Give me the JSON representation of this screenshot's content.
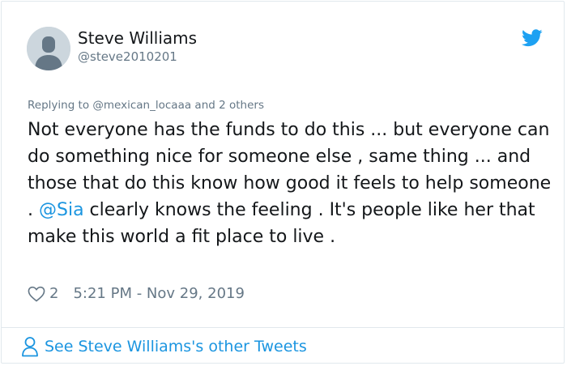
{
  "author": {
    "name": "Steve Williams",
    "handle": "@steve2010201"
  },
  "reply_context": {
    "prefix": "Replying to ",
    "user": "@mexican_locaaa",
    "suffix": " and 2 others"
  },
  "tweet": {
    "text_before": "Not everyone has the funds to do this ... but everyone can do something nice for someone else , same thing ... and those that do this know how good it feels to help someone . ",
    "mention": "@Sia",
    "text_after": " clearly knows the feeling . It's people like her that make this world a fit place to live ."
  },
  "meta": {
    "likes": "2",
    "timestamp": "5:21 PM - Nov 29, 2019"
  },
  "footer": {
    "link_label": "See Steve Williams's other Tweets"
  },
  "colors": {
    "link": "#1b95e0",
    "muted": "#657786",
    "border": "#e1e8ed"
  },
  "icons": {
    "avatar": "default-avatar-icon",
    "brand": "twitter-bird-icon",
    "like": "heart-outline-icon",
    "footer": "person-outline-icon"
  }
}
